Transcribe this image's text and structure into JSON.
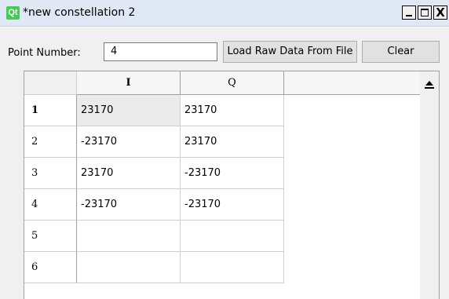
{
  "window": {
    "icon_label": "Qt",
    "title": "*new constellation 2",
    "minimize_glyph": "",
    "maximize_glyph": "",
    "close_glyph": "X"
  },
  "controls": {
    "point_number_label": "Point Number:",
    "point_number_value": "4",
    "load_button_label": "Load Raw Data From File",
    "clear_button_label": "Clear"
  },
  "table": {
    "columns": [
      "I",
      "Q",
      ""
    ],
    "rows": [
      {
        "header": "1",
        "i": "23170",
        "q": "23170"
      },
      {
        "header": "2",
        "i": "-23170",
        "q": "23170"
      },
      {
        "header": "3",
        "i": "23170",
        "q": "-23170"
      },
      {
        "header": "4",
        "i": "-23170",
        "q": "-23170"
      },
      {
        "header": "5",
        "i": "",
        "q": ""
      },
      {
        "header": "6",
        "i": "",
        "q": ""
      }
    ]
  }
}
